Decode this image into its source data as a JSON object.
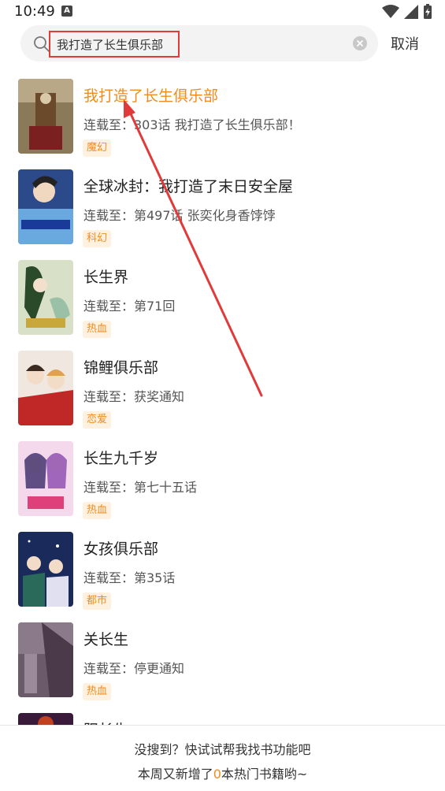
{
  "status_bar": {
    "time": "10:49",
    "notification_badge": "A"
  },
  "search": {
    "query": "我打造了长生俱乐部",
    "cancel_label": "取消"
  },
  "results": [
    {
      "title": "我打造了长生俱乐部",
      "subtitle": "连载至：303话 我打造了长生俱乐部！",
      "tag": "魔幻",
      "highlight": true
    },
    {
      "title": "全球冰封：我打造了末日安全屋",
      "subtitle": "连载至：第497话 张奕化身香饽饽",
      "tag": "科幻"
    },
    {
      "title": "长生界",
      "subtitle": "连载至：第71回",
      "tag": "热血"
    },
    {
      "title": "锦鲤俱乐部",
      "subtitle": "连载至：获奖通知",
      "tag": "恋爱"
    },
    {
      "title": "长生九千岁",
      "subtitle": "连载至：第七十五话",
      "tag": "热血"
    },
    {
      "title": "女孩俱乐部",
      "subtitle": "连载至：第35话",
      "tag": "都市"
    },
    {
      "title": "关长生",
      "subtitle": "连载至：停更通知",
      "tag": "热血"
    },
    {
      "title": "阳长生"
    }
  ],
  "bottom": {
    "line1": "没搜到？快试试帮我找书功能吧",
    "line2_prefix": "本周又新增了",
    "line2_count": "0",
    "line2_suffix": "本热门书籍哟~"
  },
  "colors": {
    "accent": "#f08c1e",
    "annotation_red": "#e03a3a",
    "search_bg": "#f3f3f3"
  }
}
